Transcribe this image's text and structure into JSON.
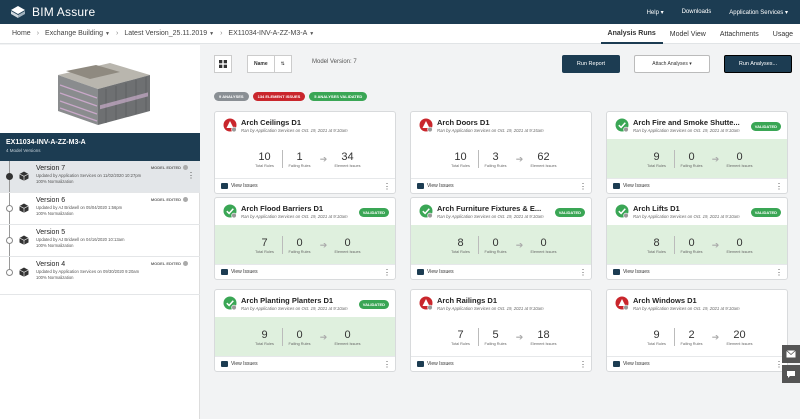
{
  "app": {
    "title": "BIM Assure"
  },
  "topnav": {
    "help": "Help ▾",
    "downloads": "Downloads",
    "services": "Application Services ▾"
  },
  "breadcrumb": [
    "Home",
    "Exchange Building",
    "Latest Version_25.11.2019",
    "EX11034-INV-A-ZZ-M3-A"
  ],
  "tabs": [
    "Analysis Runs",
    "Model View",
    "Attachments",
    "Usage"
  ],
  "project": {
    "name": "EX11034-INV-A-ZZ-M3-A",
    "count": "4 Model Versions"
  },
  "versions": [
    {
      "name": "Version 7",
      "badge": "MODEL EDITED",
      "updated": "Updated by Application Services on 11/02/2020 10:27pm",
      "norm": "100% Normalization"
    },
    {
      "name": "Version 6",
      "badge": "MODEL EDITED",
      "updated": "Updated by AJ Bridwell on 05/04/2020 1:56pm",
      "norm": "100% Normalization"
    },
    {
      "name": "Version 5",
      "badge": "",
      "updated": "Updated by AJ Bridwell on 04/16/2020 10:13am",
      "norm": "100% Normalization"
    },
    {
      "name": "Version 4",
      "badge": "MODEL EDITED",
      "updated": "Updated by Application Services on 09/30/2020 9:20am",
      "norm": "100% Normalization"
    }
  ],
  "toolbar": {
    "name_label": "Name",
    "model_version": "Model Version:  7",
    "run_report": "Run Report",
    "attach": "Attach Analyses ▾",
    "run_analyses": "Run Analyses..."
  },
  "pills": [
    {
      "label": "9 ANALYSES",
      "color": "#8a8f94"
    },
    {
      "label": "134 ELEMENT ISSUES",
      "color": "#c9262c"
    },
    {
      "label": "5 ANALYSES VALIDATED",
      "color": "#3aa655"
    }
  ],
  "labels": {
    "total_rules": "Total Rules",
    "failing_rules": "Failing Rules",
    "element_issues": "Element Issues",
    "view_issues": "View Issues",
    "validated": "VALIDATED"
  },
  "cards": [
    {
      "title": "Arch Ceilings D1",
      "sub": "Ran by Application Services on Oct. 19, 2021 at 9:10am",
      "validated": false,
      "total": "10",
      "failing": "1",
      "issues": "34"
    },
    {
      "title": "Arch Doors D1",
      "sub": "Ran by Application Services on Oct. 19, 2021 at 9:15am",
      "validated": false,
      "total": "10",
      "failing": "3",
      "issues": "62"
    },
    {
      "title": "Arch Fire and Smoke Shutte...",
      "sub": "Ran by Application Services on Oct. 19, 2021 at 9:10am",
      "validated": true,
      "total": "9",
      "failing": "0",
      "issues": "0"
    },
    {
      "title": "Arch Flood Barriers D1",
      "sub": "Ran by Application Services on Oct. 19, 2021 at 9:10am",
      "validated": true,
      "total": "7",
      "failing": "0",
      "issues": "0"
    },
    {
      "title": "Arch Furniture Fixtures & E...",
      "sub": "Ran by Application Services on Oct. 19, 2021 at 9:10am",
      "validated": true,
      "total": "8",
      "failing": "0",
      "issues": "0"
    },
    {
      "title": "Arch Lifts D1",
      "sub": "Ran by Application Services on Oct. 19, 2021 at 9:10am",
      "validated": true,
      "total": "8",
      "failing": "0",
      "issues": "0"
    },
    {
      "title": "Arch Planting Planters D1",
      "sub": "Ran by Application Services on Oct. 19, 2021 at 9:10am",
      "validated": true,
      "total": "9",
      "failing": "0",
      "issues": "0"
    },
    {
      "title": "Arch Railings D1",
      "sub": "Ran by Application Services on Oct. 19, 2021 at 9:10am",
      "validated": false,
      "total": "7",
      "failing": "5",
      "issues": "18"
    },
    {
      "title": "Arch Windows D1",
      "sub": "Ran by Application Services on Oct. 19, 2021 at 9:10am",
      "validated": false,
      "total": "9",
      "failing": "2",
      "issues": "20"
    }
  ]
}
